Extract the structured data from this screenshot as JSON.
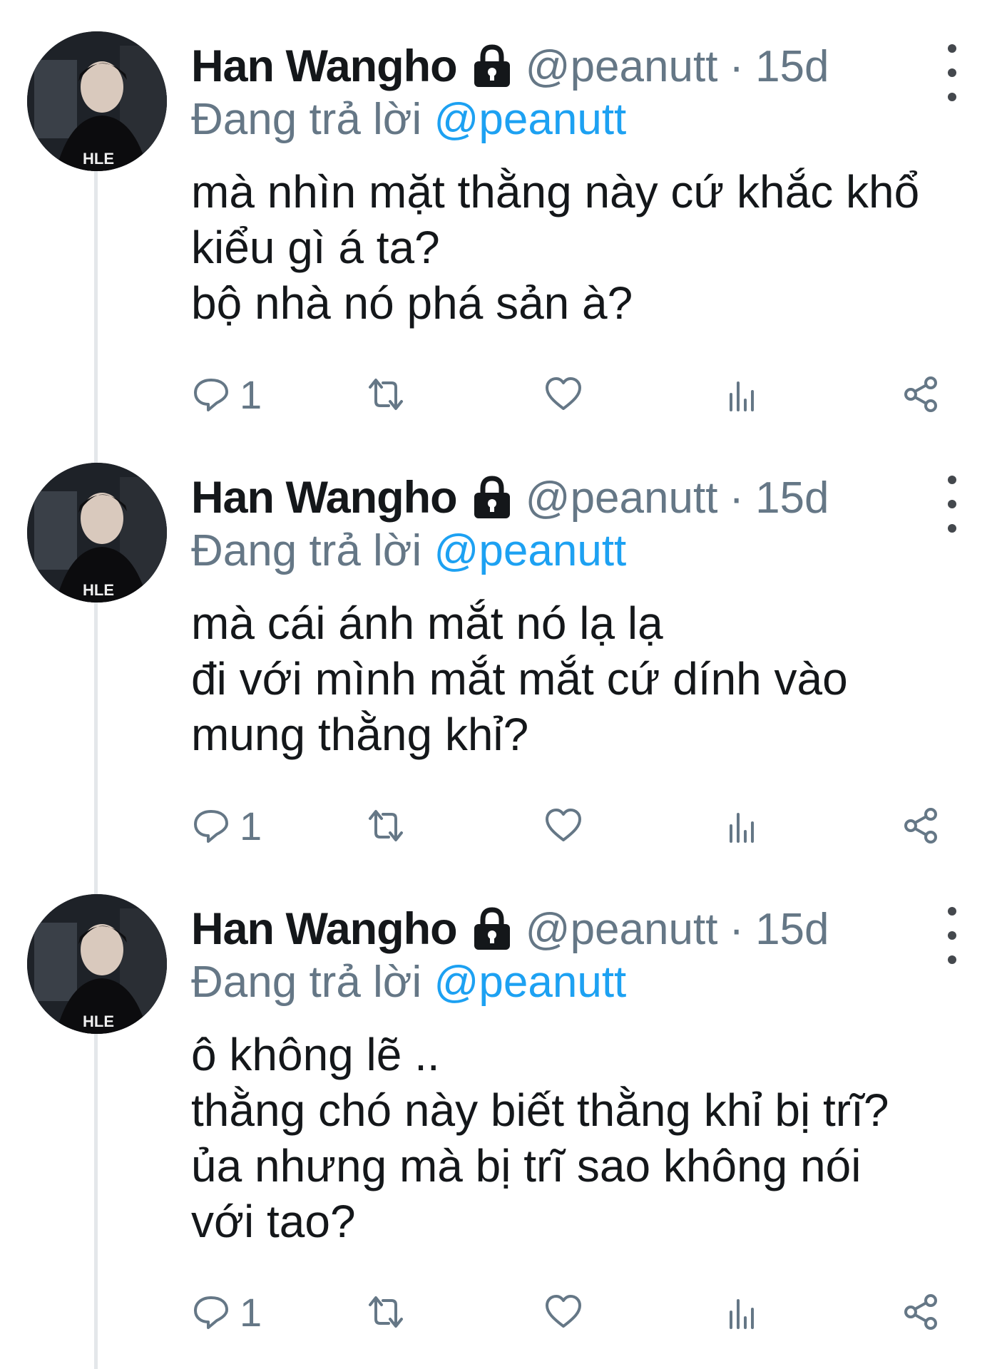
{
  "tweets": [
    {
      "author": {
        "name": "Han Wangho",
        "handle": "@peanutt",
        "protected_icon": "lock-icon",
        "avatar_text": "HLE"
      },
      "separator": "·",
      "time": "15d",
      "reply": {
        "prefix": "Đang trả lời",
        "handle": "@peanutt"
      },
      "lines": [
        "mà nhìn mặt thằng này cứ khắc khổ",
        "kiểu gì á ta?",
        "bộ nhà nó phá sản à?"
      ],
      "reply_count": "1"
    },
    {
      "author": {
        "name": "Han Wangho",
        "handle": "@peanutt",
        "protected_icon": "lock-icon",
        "avatar_text": "HLE"
      },
      "separator": "·",
      "time": "15d",
      "reply": {
        "prefix": "Đang trả lời",
        "handle": "@peanutt"
      },
      "lines": [
        "mà cái ánh mắt nó lạ lạ",
        "đi với mình mắt mắt cứ dính vào",
        "mung thằng khỉ?"
      ],
      "reply_count": "1"
    },
    {
      "author": {
        "name": "Han Wangho",
        "handle": "@peanutt",
        "protected_icon": "lock-icon",
        "avatar_text": "HLE"
      },
      "separator": "·",
      "time": "15d",
      "reply": {
        "prefix": "Đang trả lời",
        "handle": "@peanutt"
      },
      "lines": [
        "ô không lẽ ..",
        "thằng chó này biết thằng khỉ bị trĩ?",
        "ủa nhưng mà bị trĩ sao không nói",
        "với tao?"
      ],
      "reply_count": "1"
    }
  ],
  "icons": [
    "reply-icon",
    "retweet-icon",
    "like-icon",
    "analytics-icon",
    "share-icon"
  ],
  "colors": {
    "text": "#14171a",
    "secondary": "#657786",
    "link": "#1da1f2",
    "thread_line": "#e4e7ea"
  }
}
